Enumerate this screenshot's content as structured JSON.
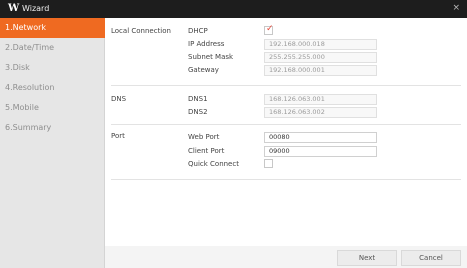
{
  "window": {
    "logo": "W",
    "title": "Wizard",
    "close": "×"
  },
  "sidebar": {
    "items": [
      {
        "label": "1.Network",
        "active": true
      },
      {
        "label": "2.Date/Time",
        "active": false
      },
      {
        "label": "3.Disk",
        "active": false
      },
      {
        "label": "4.Resolution",
        "active": false
      },
      {
        "label": "5.Mobile",
        "active": false
      },
      {
        "label": "6.Summary",
        "active": false
      }
    ]
  },
  "local_connection": {
    "section_label": "Local Connection",
    "dhcp_label": "DHCP",
    "dhcp_checked": true,
    "ip_label": "IP Address",
    "ip_value": "192.168.000.018",
    "subnet_label": "Subnet Mask",
    "subnet_value": "255.255.255.000",
    "gateway_label": "Gateway",
    "gateway_value": "192.168.000.001"
  },
  "dns": {
    "section_label": "DNS",
    "dns1_label": "DNS1",
    "dns1_value": "168.126.063.001",
    "dns2_label": "DNS2",
    "dns2_value": "168.126.063.002"
  },
  "port": {
    "section_label": "Port",
    "web_label": "Web Port",
    "web_value": "00080",
    "client_label": "Client Port",
    "client_value": "09000",
    "quick_label": "Quick Connect",
    "quick_checked": false
  },
  "footer": {
    "next_label": "Next",
    "cancel_label": "Cancel"
  },
  "colors": {
    "accent": "#ef6a21",
    "titlebar": "#1d1d1d",
    "check": "#e8483a"
  }
}
